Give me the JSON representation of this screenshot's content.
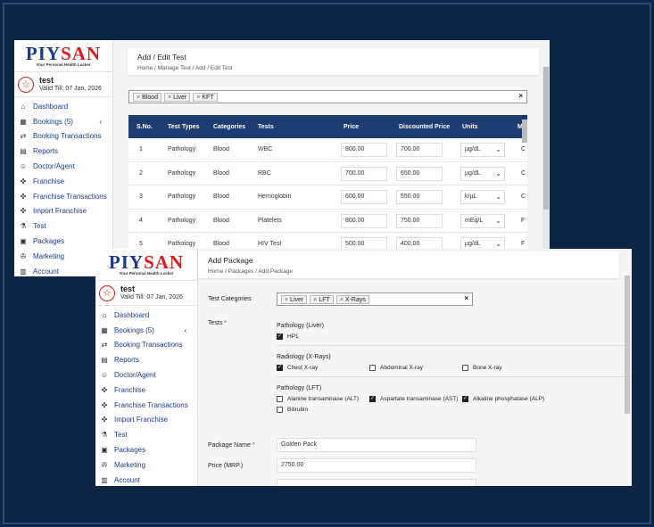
{
  "brand": {
    "part1": "PIY",
    "part2": "SAN",
    "tagline": "Your Personal Health Locker"
  },
  "user": {
    "name": "test",
    "valid": "Valid Till: 07 Jan, 2026"
  },
  "menu": [
    {
      "label": "Dashboard",
      "icon": "home-icon"
    },
    {
      "label": "Bookings (5)",
      "icon": "bookings-icon"
    },
    {
      "label": "Booking Transactions",
      "icon": "transactions-icon"
    },
    {
      "label": "Reports",
      "icon": "reports-icon"
    },
    {
      "label": "Doctor/Agent",
      "icon": "doctor-icon"
    },
    {
      "label": "Franchise",
      "icon": "franchise-icon"
    },
    {
      "label": "Franchise Transactions",
      "icon": "franchise-transactions-icon"
    },
    {
      "label": "Import Franchise",
      "icon": "import-icon"
    },
    {
      "label": "Test",
      "icon": "test-icon"
    },
    {
      "label": "Packages",
      "icon": "packages-icon"
    },
    {
      "label": "Marketing",
      "icon": "marketing-icon"
    },
    {
      "label": "Account",
      "icon": "account-icon"
    }
  ],
  "win1": {
    "title": "Add / Edit Test",
    "breadcrumb": [
      "Home",
      "Manage Test",
      "Add / Edit Test"
    ],
    "filter_tags": [
      "Blood",
      "Liver",
      "KFT"
    ],
    "columns": [
      "S.No.",
      "Test Types",
      "Categories",
      "Tests",
      "Price",
      "Discounted Price",
      "Units",
      "M"
    ],
    "rows": [
      {
        "sno": "1",
        "type": "Pathology",
        "cat": "Blood",
        "test": "WBC",
        "price": "800.00",
        "disc": "700.00",
        "unit": "µg/dL",
        "m": "C"
      },
      {
        "sno": "2",
        "type": "Pathology",
        "cat": "Blood",
        "test": "RBC",
        "price": "700.00",
        "disc": "650.00",
        "unit": "µg/dL",
        "m": "C"
      },
      {
        "sno": "3",
        "type": "Pathology",
        "cat": "Blood",
        "test": "Hemoglobin",
        "price": "600.00",
        "disc": "550.00",
        "unit": "k/µL",
        "m": "C"
      },
      {
        "sno": "4",
        "type": "Pathology",
        "cat": "Blood",
        "test": "Platelets",
        "price": "800.00",
        "disc": "750.00",
        "unit": "mEq/L",
        "m": "F"
      },
      {
        "sno": "5",
        "type": "Pathology",
        "cat": "Blood",
        "test": "HIV Test",
        "price": "500.00",
        "disc": "400.00",
        "unit": "µg/dL",
        "m": "F"
      }
    ]
  },
  "win2": {
    "title": "Add Package",
    "breadcrumb": [
      "Home",
      "Packages",
      "Add Package"
    ],
    "test_categories_label": "Test Categories",
    "category_tags": [
      "Liver",
      "LFT",
      "X-Rays"
    ],
    "tests_label": "Tests",
    "groups": [
      {
        "title": "Pathology (Liver)",
        "items": [
          {
            "label": "HP1",
            "checked": true
          }
        ]
      },
      {
        "title": "Radiology (X-Rays)",
        "items": [
          {
            "label": "Chest X-ray",
            "checked": true
          },
          {
            "label": "Abdominal X-ray",
            "checked": false
          },
          {
            "label": "Bone X-ray",
            "checked": false
          }
        ]
      },
      {
        "title": "Pathology (LFT)",
        "items": [
          {
            "label": "Alanine transaminase (ALT)",
            "checked": false
          },
          {
            "label": "Aspartate transaminase (AST)",
            "checked": true
          },
          {
            "label": "Alkaline phosphatase (ALP)",
            "checked": true
          },
          {
            "label": "Bilirubin",
            "checked": false
          }
        ]
      }
    ],
    "package_name_label": "Package Name",
    "package_name_value": "Golden Pack",
    "price_label": "Price (MRP.)",
    "price_value": "2750.00"
  },
  "colors": {
    "header": "#1f3c73",
    "brand_blue": "#1f3a8a",
    "brand_red": "#d12020",
    "background": "#0f2545"
  }
}
